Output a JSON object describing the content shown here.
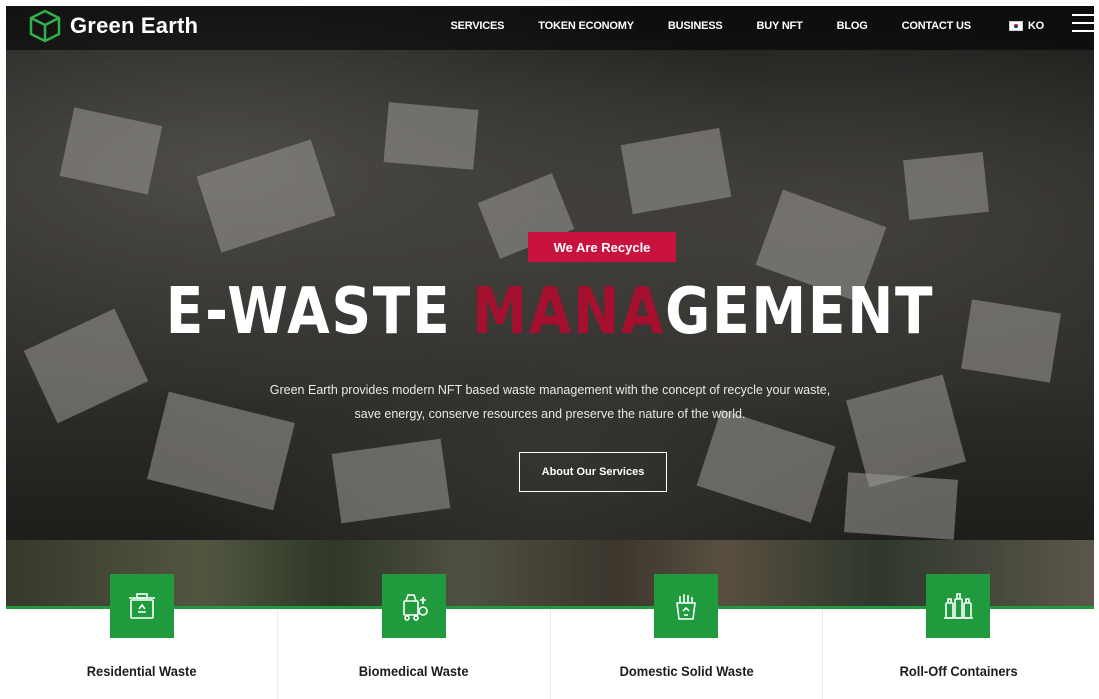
{
  "brand": {
    "name": "Green Earth",
    "logo_icon": "cube-logo-icon",
    "accent": "#1f9a3c"
  },
  "nav": {
    "items": [
      {
        "label": "SERVICES"
      },
      {
        "label": "TOKEN ECONOMY"
      },
      {
        "label": "BUSINESS"
      },
      {
        "label": "BUY NFT"
      },
      {
        "label": "BLOG"
      },
      {
        "label": "CONTACT US"
      }
    ],
    "language": {
      "code": "KO",
      "flag_icon": "korea-flag-icon"
    },
    "menu_icon": "hamburger-menu-icon"
  },
  "hero": {
    "badge": "We Are Recycle",
    "headline_pre": "E-WASTE ",
    "headline_accent": "MANA",
    "headline_post": "GEMENT",
    "subtext_line1": "Green Earth provides modern NFT based waste management with the concept of recycle your waste,",
    "subtext_line2": "save energy, conserve resources and preserve the nature of the world.",
    "cta_label": "About Our Services",
    "badge_color": "#c8133f"
  },
  "services": [
    {
      "title": "Residential Waste",
      "icon": "recycle-bin-icon"
    },
    {
      "title": "Biomedical Waste",
      "icon": "biomedical-waste-icon"
    },
    {
      "title": "Domestic Solid Waste",
      "icon": "waste-container-icon"
    },
    {
      "title": "Roll-Off Containers",
      "icon": "bottles-containers-icon"
    }
  ]
}
